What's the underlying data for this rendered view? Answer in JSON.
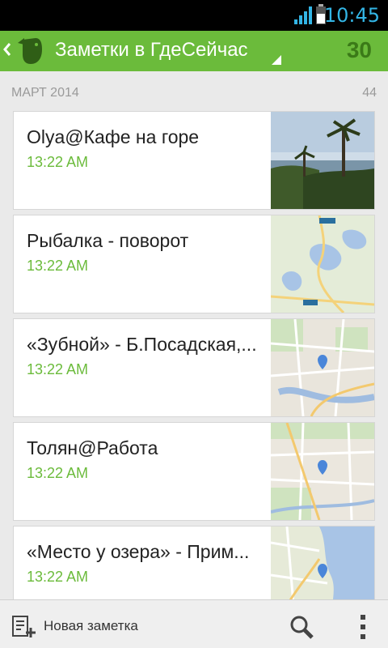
{
  "status_bar": {
    "time": "10:45"
  },
  "action_bar": {
    "title": "Заметки в ГдеСейчас",
    "count": "30"
  },
  "section": {
    "label": "МАРТ 2014",
    "count": "44"
  },
  "notes": [
    {
      "title": "Olya@Кафе на горе",
      "time": "13:22 AM",
      "thumb": "photo"
    },
    {
      "title": "Рыбалка - поворот",
      "time": "13:22 AM",
      "thumb": "map-lakes"
    },
    {
      "title": "«Зубной» - Б.Посадская,...",
      "time": "13:22 AM",
      "thumb": "map-city"
    },
    {
      "title": "Толян@Работа",
      "time": "13:22 AM",
      "thumb": "map-district"
    },
    {
      "title": "«Место у озера» - Прим...",
      "time": "13:22 AM",
      "thumb": "map-coast"
    }
  ],
  "bottom_bar": {
    "new_note_label": "Новая заметка"
  },
  "colors": {
    "accent": "#6bbb3b",
    "accent_dark": "#3b7a18",
    "clock": "#33b5e5"
  }
}
